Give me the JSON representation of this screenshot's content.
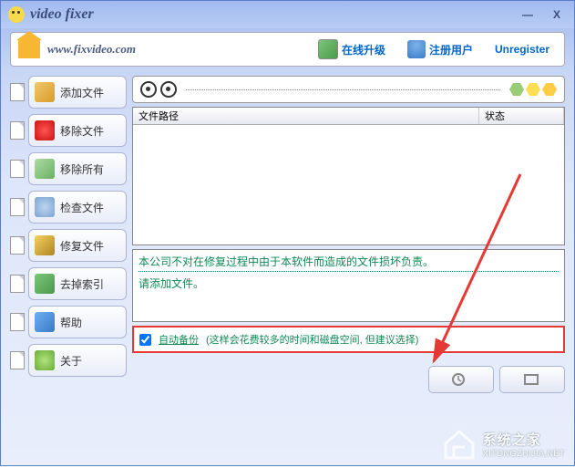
{
  "window": {
    "title": "video fixer"
  },
  "topbar": {
    "url": "www.fixvideo.com",
    "upgrade": "在线升级",
    "register": "注册用户",
    "unregister": "Unregister"
  },
  "sidebar": {
    "items": [
      {
        "label": "添加文件",
        "icon": "sb-add"
      },
      {
        "label": "移除文件",
        "icon": "sb-remove"
      },
      {
        "label": "移除所有",
        "icon": "sb-removeall"
      },
      {
        "label": "检查文件",
        "icon": "sb-check"
      },
      {
        "label": "修复文件",
        "icon": "sb-repair"
      },
      {
        "label": "去掉索引",
        "icon": "sb-index"
      },
      {
        "label": "帮助",
        "icon": "sb-help"
      },
      {
        "label": "关于",
        "icon": "sb-about"
      }
    ]
  },
  "filelist": {
    "col_path": "文件路径",
    "col_status": "状态"
  },
  "log": {
    "line1": "本公司不对在修复过程中由于本软件而造成的文件损坏负责。",
    "line2": "请添加文件。"
  },
  "backup": {
    "checked": true,
    "label": "自动备份",
    "hint": "(这样会花费较多的时间和磁盘空间, 但建议选择)"
  },
  "watermark": {
    "cn": "系统之家",
    "url": "XITONGZHIJIA.NET"
  }
}
